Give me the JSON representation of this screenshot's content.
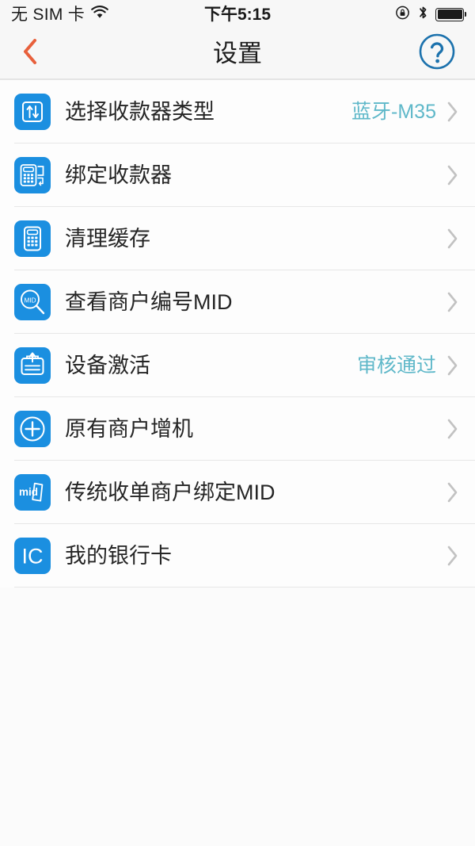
{
  "statusbar": {
    "carrier": "无 SIM 卡",
    "time": "下午5:15",
    "wifi_icon": "wifi-icon",
    "rotation_lock_icon": "rotation-lock-icon",
    "bluetooth_icon": "bluetooth-icon",
    "battery_icon": "battery-full-icon",
    "battery_level": 100
  },
  "navbar": {
    "back_icon": "chevron-left-icon",
    "title": "设置",
    "help_icon": "question-mark-circle-icon"
  },
  "colors": {
    "icon_blue": "#1b8fe0",
    "value_teal": "#5fb8c9",
    "back_orange": "#e8603c",
    "help_blue": "#1c72ad",
    "chevron_gray": "#c2c2c2",
    "page_background": "#fbfbfb",
    "row_background": "#fdfdfd",
    "separator": "#e7e7e7"
  },
  "list": {
    "rows": [
      {
        "label": "选择收款器类型",
        "value": "蓝牙-M35",
        "icon": "transfer-arrows-square-icon",
        "chevron": "chevron-right-icon"
      },
      {
        "label": "绑定收款器",
        "value": "",
        "icon": "pos-terminal-icon",
        "chevron": "chevron-right-icon"
      },
      {
        "label": "清理缓存",
        "value": "",
        "icon": "calculator-icon",
        "chevron": "chevron-right-icon"
      },
      {
        "label": "查看商户编号MID",
        "value": "",
        "icon": "magnifier-mid-icon",
        "chevron": "chevron-right-icon"
      },
      {
        "label": "设备激活",
        "value": "审核通过",
        "icon": "device-activate-upload-icon",
        "chevron": "chevron-right-icon"
      },
      {
        "label": "原有商户增机",
        "value": "",
        "icon": "plus-circle-icon",
        "chevron": "chevron-right-icon"
      },
      {
        "label": "传统收单商户绑定MID",
        "value": "",
        "icon": "mid-card-icon",
        "chevron": "chevron-right-icon"
      },
      {
        "label": "我的银行卡",
        "value": "",
        "icon": "ic-card-icon",
        "chevron": "chevron-right-icon"
      }
    ]
  }
}
